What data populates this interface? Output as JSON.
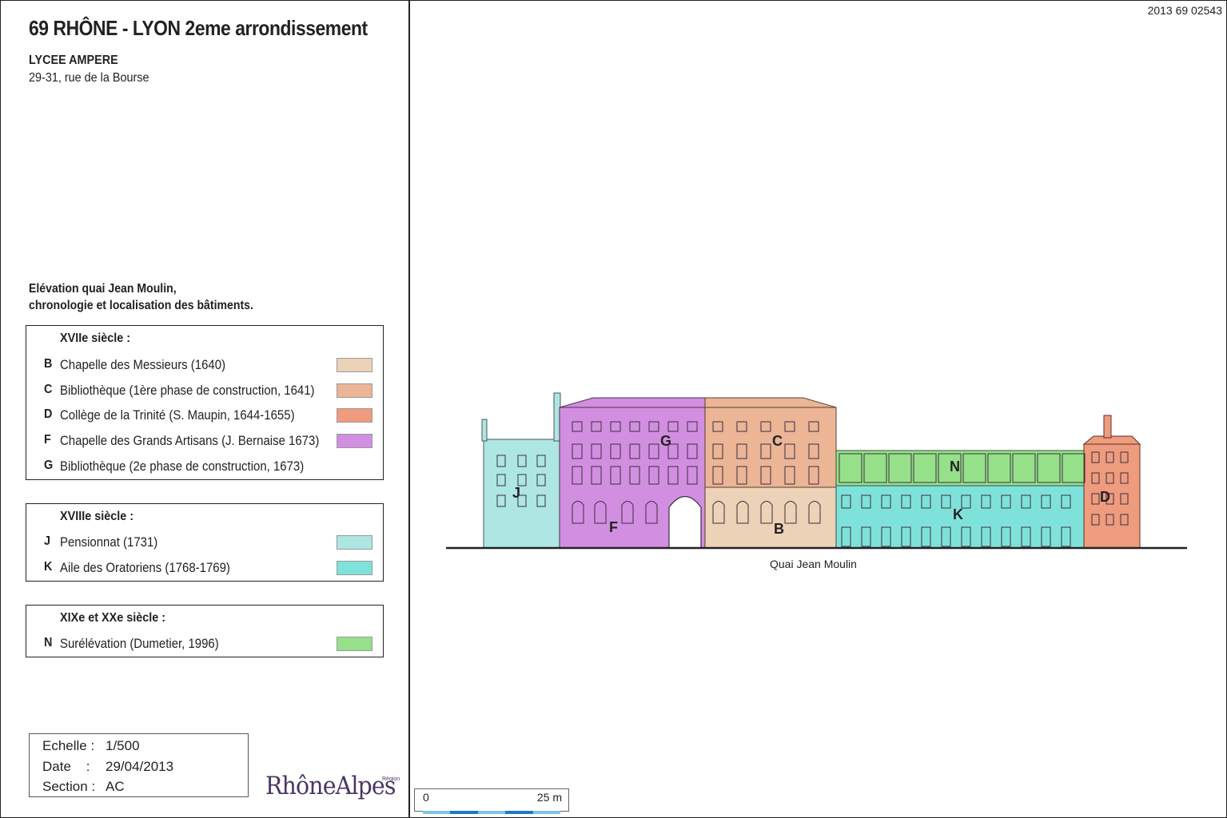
{
  "reference": "2013 69 02543",
  "title": "69 RHÔNE - LYON 2eme arrondissement",
  "subtitle": "LYCEE AMPERE",
  "address": "29-31, rue de la Bourse",
  "caption": {
    "line1": "Elévation quai Jean Moulin,",
    "line2": "chronologie et localisation des bâtiments."
  },
  "legend": [
    {
      "heading": "XVIIe siècle :",
      "items": [
        {
          "code": "B",
          "label": "Chapelle des Messieurs (1640)",
          "color": "#ecd2b6"
        },
        {
          "code": "C",
          "label": "Bibliothèque (1ère phase de construction, 1641)",
          "color": "#ebb596"
        },
        {
          "code": "D",
          "label": "Collège de la Trinité (S. Maupin, 1644-1655)",
          "color": "#ee9b7e"
        },
        {
          "code": "F",
          "label": "Chapelle des Grands Artisans (J. Bernaise 1673)",
          "color": "#d28ee0"
        },
        {
          "code": "G",
          "label": "Bibliothèque (2e phase de construction, 1673)",
          "color": ""
        }
      ]
    },
    {
      "heading": "XVIIIe siècle :",
      "items": [
        {
          "code": "J",
          "label": "Pensionnat (1731)",
          "color": "#ade6e2"
        },
        {
          "code": "K",
          "label": "Aile des Oratoriens (1768-1769)",
          "color": "#7fe2da"
        }
      ]
    },
    {
      "heading": "XIXe et XXe siècle :",
      "items": [
        {
          "code": "N",
          "label": "Surélévation (Dumetier, 1996)",
          "color": "#96e08a"
        }
      ]
    }
  ],
  "info": {
    "scale_label": "Echelle :",
    "scale_value": "1/500",
    "date_label": "Date    :",
    "date_value": "29/04/2013",
    "section_label": "Section :",
    "section_value": "AC"
  },
  "logo": {
    "text": "RhôneAlpes",
    "region": "Région"
  },
  "scalebar": {
    "start": "0",
    "end": "25 m"
  },
  "street_label": "Quai Jean Moulin",
  "elevation_labels": {
    "J": "J",
    "G": "G",
    "F": "F",
    "C": "C",
    "B": "B",
    "N": "N",
    "K": "K",
    "D": "D"
  }
}
